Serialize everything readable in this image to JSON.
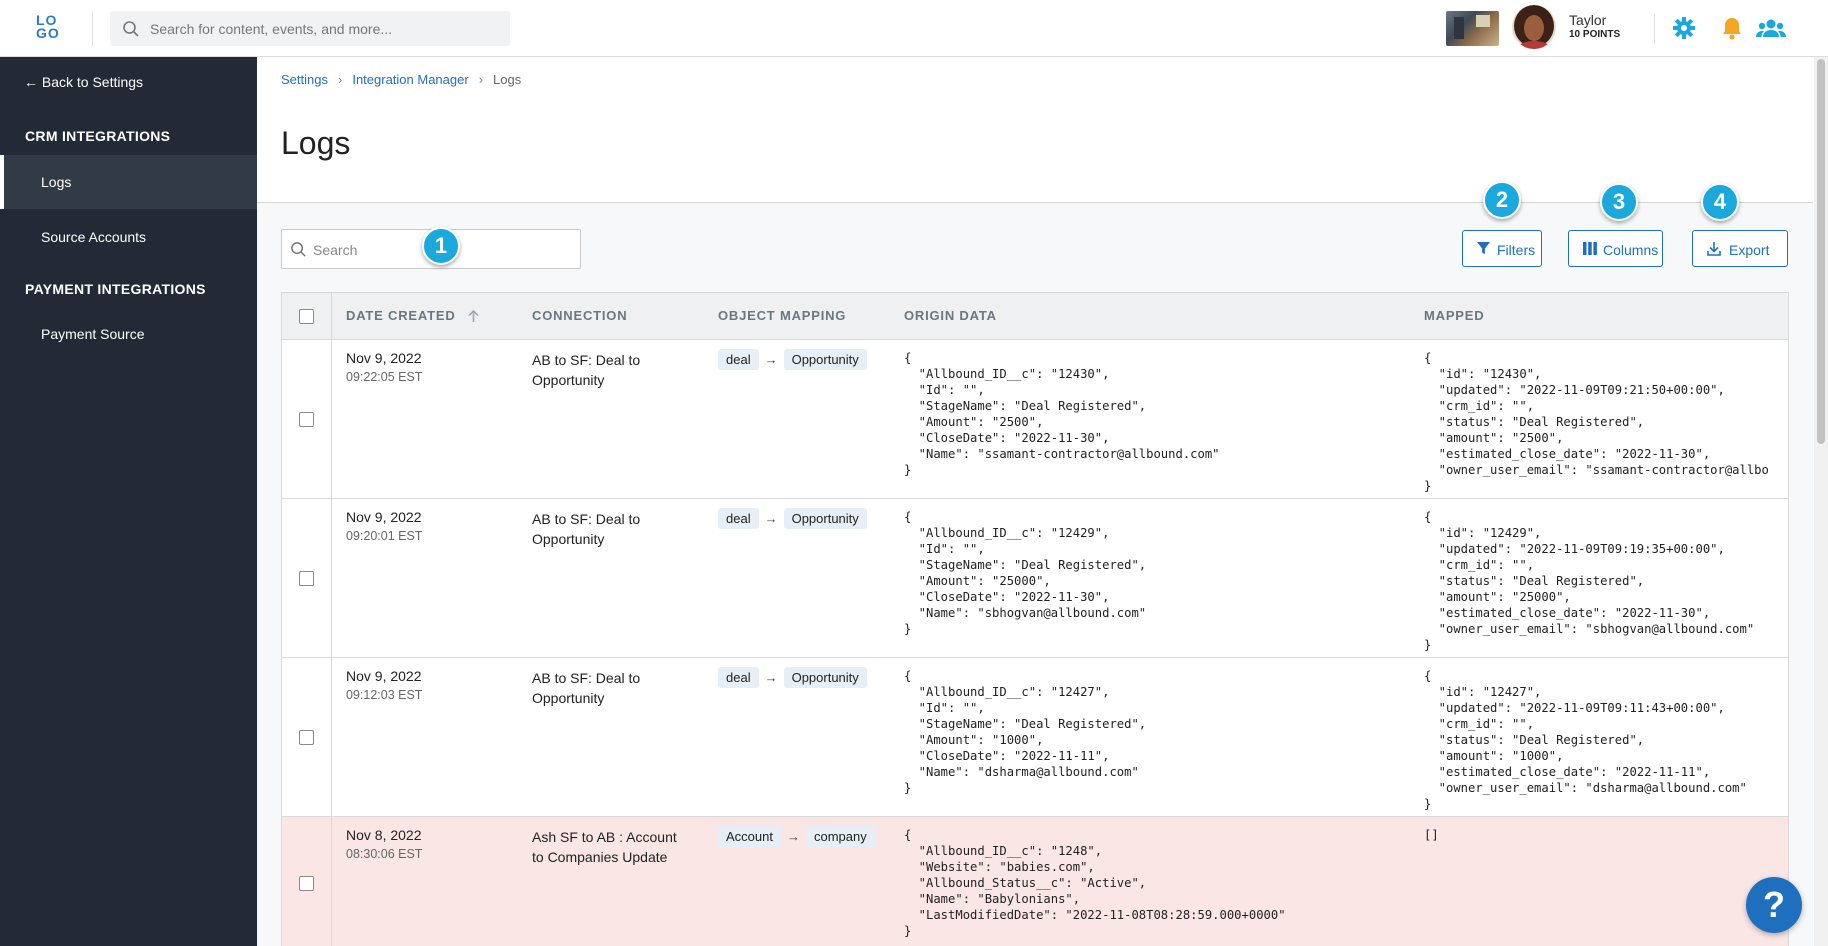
{
  "header": {
    "logo_top": "LO",
    "logo_bottom": "GO",
    "search_placeholder": "Search for content, events, and more...",
    "user_name": "Taylor",
    "user_points": "10 POINTS",
    "accent_color": "#1aa8dd",
    "icons": [
      "search-icon",
      "gear-icon",
      "bell-icon",
      "users-icon"
    ]
  },
  "sidebar": {
    "back_label": "← Back to Settings",
    "crm_heading": "CRM INTEGRATIONS",
    "crm_items": [
      "Logs",
      "Source Accounts"
    ],
    "payment_heading": "PAYMENT INTEGRATIONS",
    "payment_items": [
      "Payment Source"
    ]
  },
  "breadcrumb": [
    "Settings",
    "Integration Manager",
    "Logs"
  ],
  "page": {
    "title": "Logs",
    "search_placeholder": "Search",
    "buttons": {
      "filters": "Filters",
      "columns": "Columns",
      "export": "Export"
    },
    "badges": [
      "1",
      "2",
      "3",
      "4"
    ]
  },
  "table": {
    "columns": [
      "DATE CREATED",
      "CONNECTION",
      "OBJECT MAPPING",
      "ORIGIN DATA",
      "MAPPED"
    ],
    "rows": [
      {
        "date": "Nov 9, 2022",
        "time": "09:22:05 EST",
        "connection": "AB to SF: Deal to Opportunity",
        "from": "deal",
        "to": "Opportunity",
        "status": "ok",
        "origin": "{\n  \"Allbound_ID__c\": \"12430\",\n  \"Id\": \"\",\n  \"StageName\": \"Deal Registered\",\n  \"Amount\": \"2500\",\n  \"CloseDate\": \"2022-11-30\",\n  \"Name\": \"ssamant-contractor@allbound.com\"\n}",
        "mapped": "{\n  \"id\": \"12430\",\n  \"updated\": \"2022-11-09T09:21:50+00:00\",\n  \"crm_id\": \"\",\n  \"status\": \"Deal Registered\",\n  \"amount\": \"2500\",\n  \"estimated_close_date\": \"2022-11-30\",\n  \"owner_user_email\": \"ssamant-contractor@allbo\n}"
      },
      {
        "date": "Nov 9, 2022",
        "time": "09:20:01 EST",
        "connection": "AB to SF: Deal to Opportunity",
        "from": "deal",
        "to": "Opportunity",
        "status": "ok",
        "origin": "{\n  \"Allbound_ID__c\": \"12429\",\n  \"Id\": \"\",\n  \"StageName\": \"Deal Registered\",\n  \"Amount\": \"25000\",\n  \"CloseDate\": \"2022-11-30\",\n  \"Name\": \"sbhogvan@allbound.com\"\n}",
        "mapped": "{\n  \"id\": \"12429\",\n  \"updated\": \"2022-11-09T09:19:35+00:00\",\n  \"crm_id\": \"\",\n  \"status\": \"Deal Registered\",\n  \"amount\": \"25000\",\n  \"estimated_close_date\": \"2022-11-30\",\n  \"owner_user_email\": \"sbhogvan@allbound.com\"\n}"
      },
      {
        "date": "Nov 9, 2022",
        "time": "09:12:03 EST",
        "connection": "AB to SF: Deal to Opportunity",
        "from": "deal",
        "to": "Opportunity",
        "status": "ok",
        "origin": "{\n  \"Allbound_ID__c\": \"12427\",\n  \"Id\": \"\",\n  \"StageName\": \"Deal Registered\",\n  \"Amount\": \"1000\",\n  \"CloseDate\": \"2022-11-11\",\n  \"Name\": \"dsharma@allbound.com\"\n}",
        "mapped": "{\n  \"id\": \"12427\",\n  \"updated\": \"2022-11-09T09:11:43+00:00\",\n  \"crm_id\": \"\",\n  \"status\": \"Deal Registered\",\n  \"amount\": \"1000\",\n  \"estimated_close_date\": \"2022-11-11\",\n  \"owner_user_email\": \"dsharma@allbound.com\"\n}"
      },
      {
        "date": "Nov 8, 2022",
        "time": "08:30:06 EST",
        "connection": "Ash SF to AB : Account to Companies Update",
        "from": "Account",
        "to": "company",
        "status": "error",
        "origin": "{\n  \"Allbound_ID__c\": \"1248\",\n  \"Website\": \"babies.com\",\n  \"Allbound_Status__c\": \"Active\",\n  \"Name\": \"Babylonians\",\n  \"LastModifiedDate\": \"2022-11-08T08:28:59.000+0000\"\n}",
        "mapped": "[]"
      }
    ]
  },
  "help_label": "?"
}
